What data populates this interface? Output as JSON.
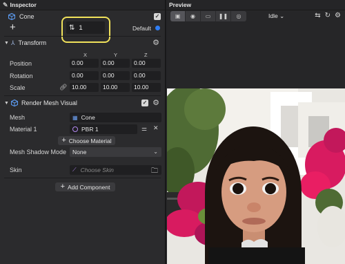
{
  "inspector": {
    "title": "Inspector",
    "object_name": "Cone",
    "layer_value": "1",
    "default_label": "Default",
    "accent": "#2f7ef5",
    "highlight": "#f1e25b"
  },
  "transform": {
    "title": "Transform",
    "axes": [
      "X",
      "Y",
      "Z"
    ],
    "rows": [
      {
        "label": "Position",
        "values": [
          "0.00",
          "0.00",
          "0.00"
        ]
      },
      {
        "label": "Rotation",
        "values": [
          "0.00",
          "0.00",
          "0.00"
        ]
      },
      {
        "label": "Scale",
        "values": [
          "10.00",
          "10.00",
          "10.00"
        ]
      }
    ]
  },
  "render_mesh": {
    "title": "Render Mesh Visual",
    "mesh_label": "Mesh",
    "mesh_value": "Cone",
    "material_label": "Material 1",
    "material_value": "PBR 1",
    "choose_material": "Choose Material",
    "shadow_label": "Mesh Shadow Mode",
    "shadow_value": "None",
    "skin_label": "Skin",
    "skin_placeholder": "Choose Skin"
  },
  "add_component": "Add Component",
  "preview": {
    "title": "Preview",
    "mode": "Idle",
    "toolbar_icons": [
      "image-icon",
      "camera-icon",
      "device-icon",
      "pause-icon",
      "eye-icon"
    ],
    "right_icons": [
      "flip-camera-icon",
      "restart-icon",
      "settings-icon"
    ]
  }
}
